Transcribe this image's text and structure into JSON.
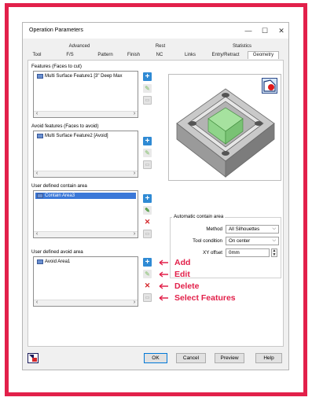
{
  "window": {
    "title": "Operation Parameters",
    "minimize": "—",
    "maximize": "☐",
    "close": "✕"
  },
  "tabs": {
    "upper": [
      "Advanced",
      "Rest",
      "Statistics"
    ],
    "lower": [
      "Tool",
      "F/S",
      "Pattern",
      "Finish",
      "NC",
      "Links",
      "Entry/Retract",
      "Geometry"
    ],
    "active": "Geometry"
  },
  "features": {
    "label": "Features (Faces to cut)",
    "items": [
      "Multi Surface Feature1 [3\" Deep Max"
    ]
  },
  "avoid_features": {
    "label": "Avoid features (Faces to avoid)",
    "items": [
      "Multi Surface Feature2 [Avoid]"
    ]
  },
  "contain_area": {
    "label": "User defined contain area",
    "items": [
      "Contain Area3"
    ]
  },
  "avoid_area": {
    "label": "User defined avoid area",
    "items": [
      "Avoid Area1"
    ]
  },
  "auto_contain": {
    "label": "Automatic contain area",
    "method_label": "Method",
    "method_value": "All Silhouettes",
    "tool_condition_label": "Tool condition",
    "tool_condition_value": "On center",
    "xy_offset_label": "XY offset",
    "xy_offset_value": "0mm"
  },
  "annotations": {
    "add": "Add",
    "edit": "Edit",
    "delete": "Delete",
    "select": "Select Features"
  },
  "buttons": {
    "ok": "OK",
    "cancel": "Cancel",
    "preview": "Preview",
    "help": "Help"
  },
  "colors": {
    "frame": "#e2204a",
    "selection": "#3b78d8",
    "add_button": "#2f8ad4",
    "delete_icon": "#d4262a",
    "feature_highlight": "#8fd48a"
  }
}
